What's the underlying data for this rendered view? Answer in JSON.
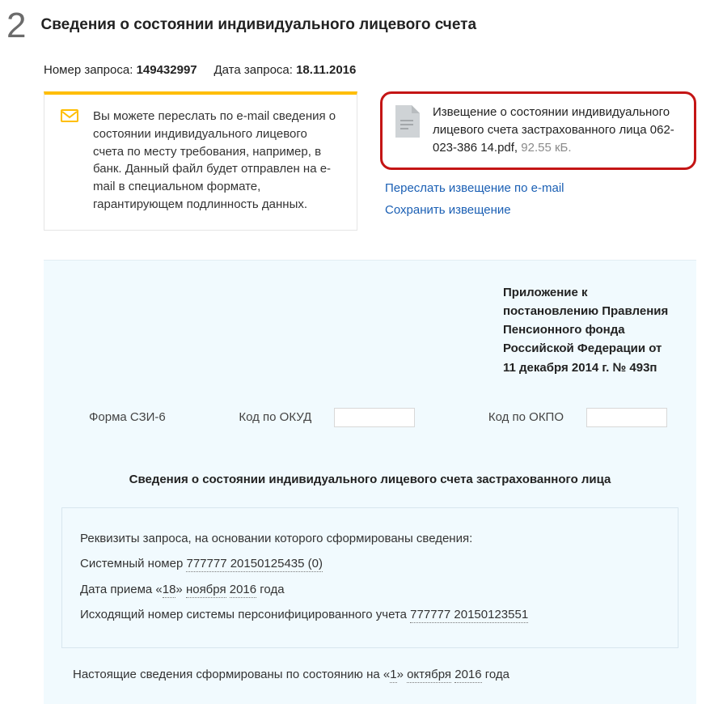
{
  "step": {
    "number": "2",
    "title": "Сведения о состоянии индивидуального лицевого счета"
  },
  "meta": {
    "request_label": "Номер запроса:",
    "request_number": "149432997",
    "date_label": "Дата запроса:",
    "date_value": "18.11.2016"
  },
  "info_card": {
    "text": "Вы можете переслать по e-mail сведения о состоянии индивидуального лицевого счета по месту требования, например, в банк. Данный файл будет отправлен на e-mail в специальном формате, гарантирующем подлинность данных."
  },
  "file": {
    "name": "Извещение о состоянии индивидуального лицевого счета застрахованного лица 062-023-386 14.pdf",
    "size": "92.55 кБ."
  },
  "links": {
    "forward": "Переслать извещение по e-mail",
    "save": "Сохранить извещение"
  },
  "annex": {
    "text": "Приложение к постановлению Правления Пенсионного фонда Российской Федерации от 11 декабря 2014 г. № 493п"
  },
  "form_row": {
    "form_label": "Форма СЗИ-6",
    "okud_label": "Код по ОКУД",
    "okpo_label": "Код по ОКПО"
  },
  "doc_title": "Сведения о состоянии индивидуального лицевого счета застрахованного лица",
  "req": {
    "intro": "Реквизиты запроса, на основании которого сформированы сведения:",
    "sys_label": "Системный номер ",
    "sys_number": "777777 20150125435 (0)",
    "date_label_pre": "Дата приема «",
    "day": "18",
    "date_label_mid": "»  ",
    "month": "ноября",
    "gap": "  ",
    "year": "2016",
    "date_label_post": "  года",
    "out_label": "Исходящий номер системы персонифицированного учета ",
    "out_number": "777777 20150123551"
  },
  "footer": {
    "pre": "Настоящие сведения сформированы по состоянию на   «",
    "day": "1",
    "mid": "»  ",
    "month": "октября",
    "gap": "  ",
    "year": "2016",
    "post": "  года"
  }
}
